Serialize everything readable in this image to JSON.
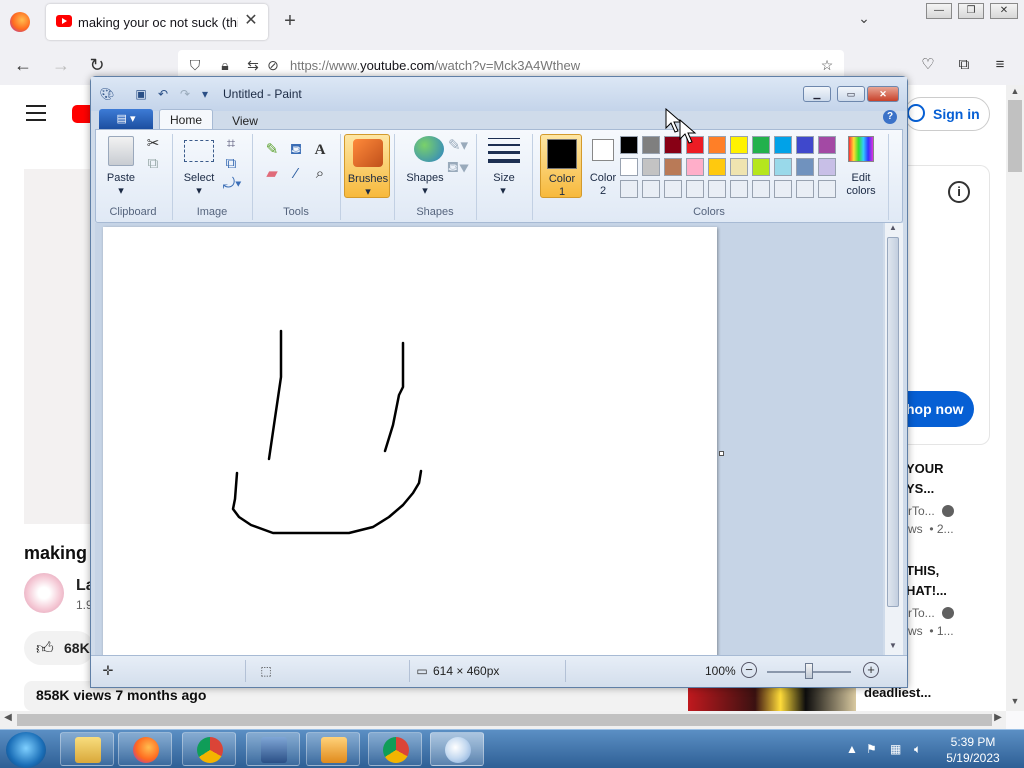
{
  "browser": {
    "tab_title": "making your oc not suck (this t",
    "tab_close": "✕",
    "new_tab": "+",
    "tab_list": "⌄",
    "url_prefix": "https://www.",
    "url_domain": "youtube.com",
    "url_suffix": "/watch?v=Mck3A4Wthew",
    "icons": {
      "back": "back-arrow-icon",
      "forward": "forward-arrow-icon",
      "reload": "reload-icon",
      "shield": "shield-icon",
      "lock": "lock-icon",
      "permissions": "permissions-icon",
      "bookmark": "star-icon",
      "pocket": "pocket-icon",
      "extensions": "puzzle-icon",
      "menu": "hamburger-icon"
    }
  },
  "youtube": {
    "video_title": "making",
    "channel_name": "La",
    "channel_subs": "1.9",
    "likes": "68K",
    "views": "858K views  7 months ago",
    "sign_in": "Sign in",
    "shop_now": "hop now",
    "recommendations": [
      {
        "title": "YOUR\nYS...",
        "channel": "rTo...",
        "meta": "ws  • 2..."
      },
      {
        "title": "THIS,\nHAT!...",
        "channel": "rTo...",
        "meta": "ws  • 1..."
      },
      {
        "title": "orld's\ndeadliest...",
        "channel": "",
        "meta": ""
      }
    ]
  },
  "paint": {
    "title": "Untitled - Paint",
    "tabs": [
      "Home",
      "View"
    ],
    "groups": {
      "clipboard": "Clipboard",
      "image": "Image",
      "tools": "Tools",
      "shapes": "Shapes",
      "colors": "Colors"
    },
    "buttons": {
      "paste": "Paste",
      "select": "Select",
      "brushes": "Brushes",
      "shapes": "Shapes",
      "size": "Size",
      "color1": "Color\n1",
      "color2": "Color\n2",
      "edit_colors": "Edit\ncolors"
    },
    "help": "?",
    "status_size": "614 × 460px",
    "zoom": "100%",
    "palette_row1": [
      "#000000",
      "#7f7f7f",
      "#880015",
      "#ed1c24",
      "#ff7f27",
      "#fff200",
      "#22b14c",
      "#00a2e8",
      "#3f48cc",
      "#a349a4"
    ],
    "palette_row2": [
      "#ffffff",
      "#c3c3c3",
      "#b97a57",
      "#ffaec9",
      "#ffc90e",
      "#efe4b0",
      "#b5e61d",
      "#99d9ea",
      "#7092be",
      "#c8bfe7"
    ],
    "palette_row3": [
      "",
      "",
      "",
      "",
      "",
      "",
      "",
      "",
      "",
      ""
    ],
    "color1": "#000000",
    "color2": "#ffffff"
  },
  "taskbar": {
    "time": "5:39 PM",
    "date": "5/19/2023"
  }
}
